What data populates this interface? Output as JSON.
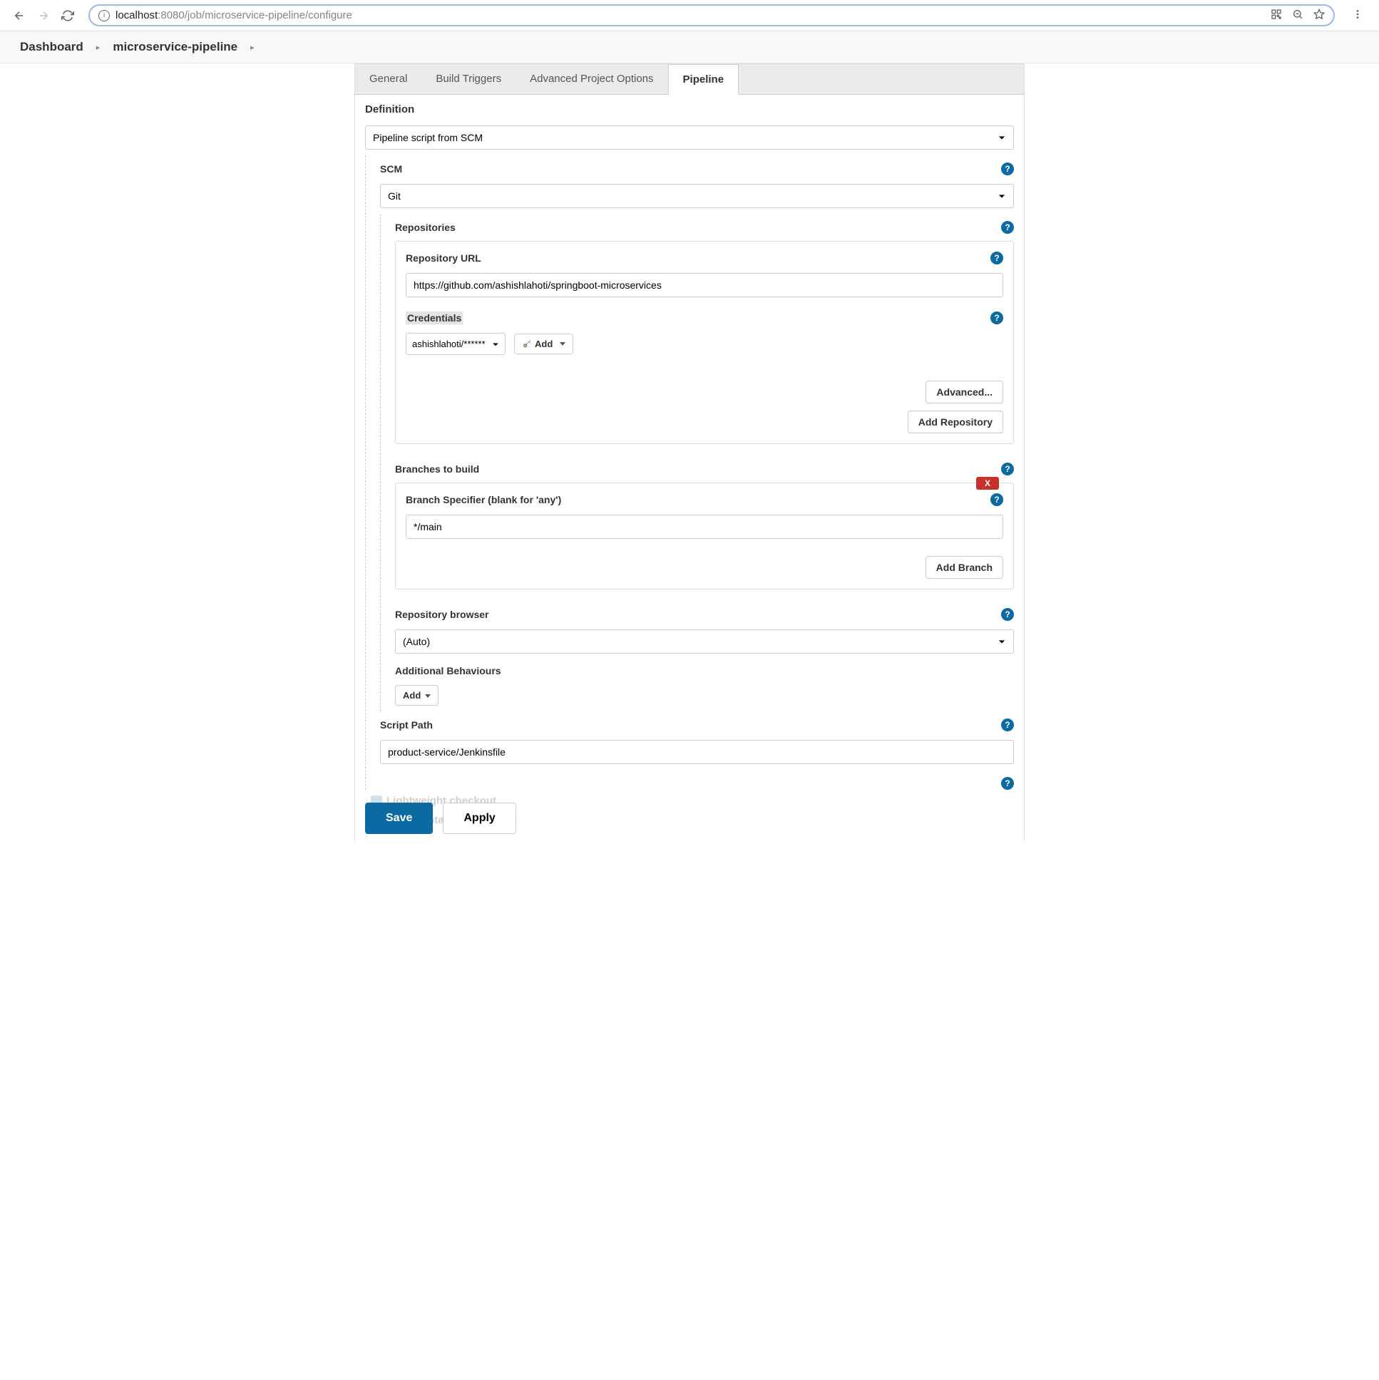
{
  "browser": {
    "url_host": "localhost",
    "url_path": ":8080/job/microservice-pipeline/configure"
  },
  "breadcrumb": {
    "items": [
      "Dashboard",
      "microservice-pipeline"
    ]
  },
  "tabs": {
    "items": [
      {
        "label": "General"
      },
      {
        "label": "Build Triggers"
      },
      {
        "label": "Advanced Project Options"
      },
      {
        "label": "Pipeline",
        "active": true
      }
    ]
  },
  "definition": {
    "label": "Definition",
    "value": "Pipeline script from SCM"
  },
  "scm": {
    "label": "SCM",
    "value": "Git"
  },
  "repositories": {
    "label": "Repositories",
    "repo_url_label": "Repository URL",
    "repo_url_value": "https://github.com/ashishlahoti/springboot-microservices",
    "credentials_label": "Credentials",
    "credentials_value": "ashishlahoti/******",
    "add_cred_label": "Add",
    "advanced_button": "Advanced...",
    "add_repo_button": "Add Repository"
  },
  "branches": {
    "label": "Branches to build",
    "specifier_label": "Branch Specifier (blank for 'any')",
    "specifier_value": "*/main",
    "add_branch_button": "Add Branch",
    "delete_label": "X"
  },
  "repo_browser": {
    "label": "Repository browser",
    "value": "(Auto)"
  },
  "additional": {
    "label": "Additional Behaviours",
    "add_button": "Add"
  },
  "script_path": {
    "label": "Script Path",
    "value": "product-service/Jenkinsfile"
  },
  "footer": {
    "ghost_line1": "Lightweight checkout",
    "ghost_line2": "Pipeline Syntax",
    "save": "Save",
    "apply": "Apply"
  }
}
